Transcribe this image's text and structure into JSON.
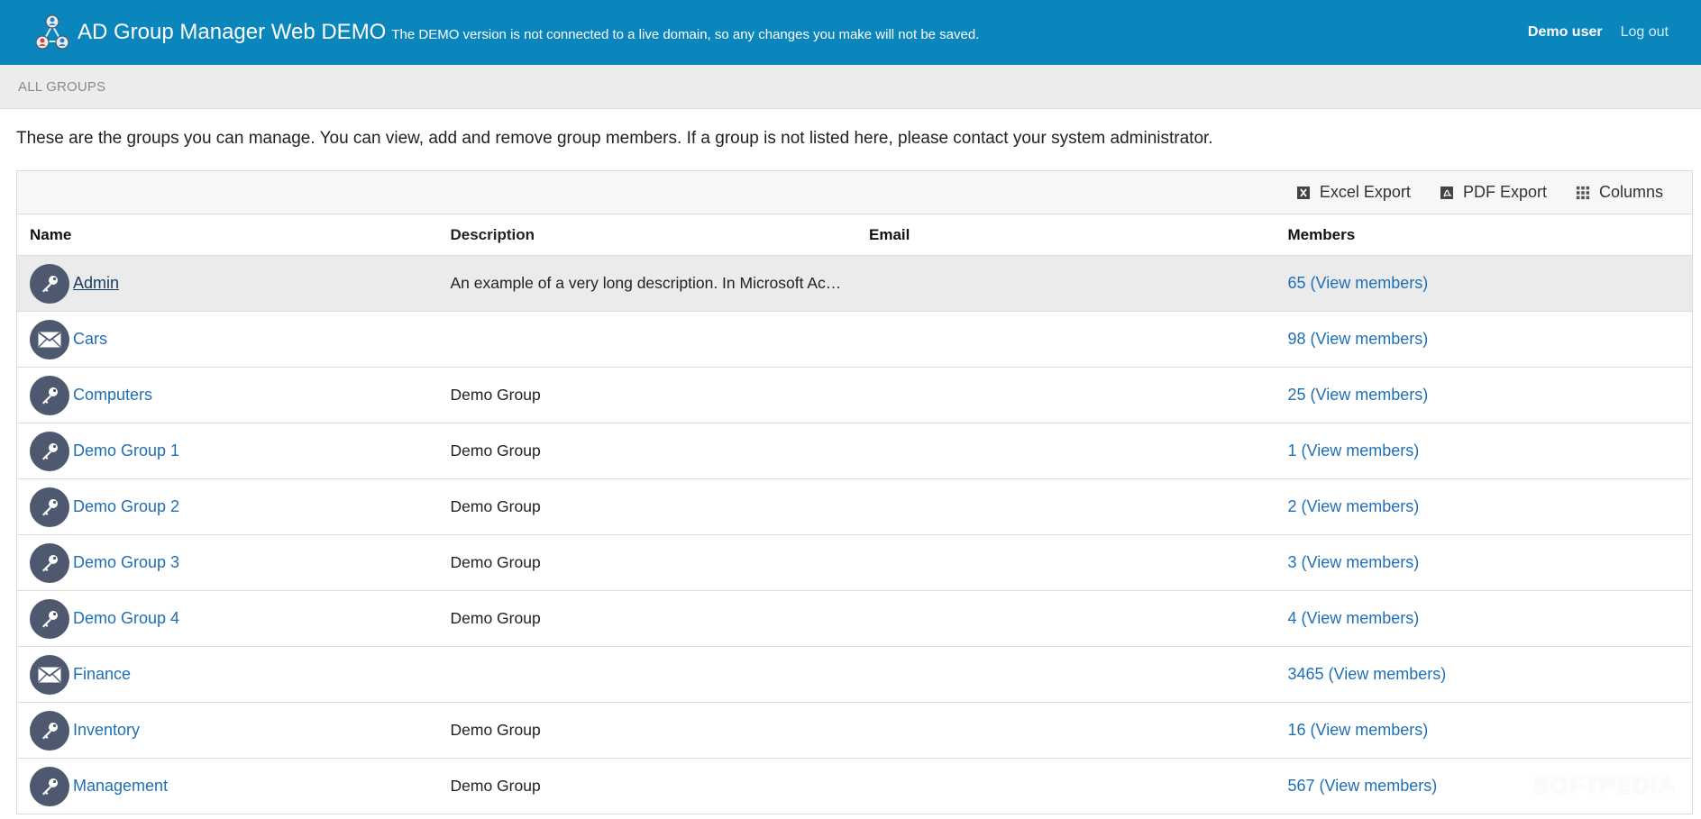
{
  "header": {
    "app_title": "AD Group Manager Web DEMO",
    "demo_note": "The DEMO version is not connected to a live domain, so any changes you make will not be saved.",
    "user_name": "Demo user",
    "logout_label": "Log out",
    "logo_icon": "group-network-logo-icon"
  },
  "breadcrumb": "ALL GROUPS",
  "intro": "These are the groups you can manage. You can view, add and remove group members. If a group is not listed here, please contact your system administrator.",
  "toolbar": {
    "excel_label": "Excel Export",
    "pdf_label": "PDF Export",
    "columns_label": "Columns"
  },
  "columns": {
    "name": "Name",
    "description": "Description",
    "email": "Email",
    "members": "Members"
  },
  "rows": [
    {
      "name": "Admin",
      "icon": "key",
      "description": "An example of a very long description. In Microsoft Ac…",
      "email": "",
      "members": "65 (View members)",
      "selected": true
    },
    {
      "name": "Cars",
      "icon": "mail",
      "description": "",
      "email": "",
      "members": "98 (View members)"
    },
    {
      "name": "Computers",
      "icon": "key",
      "description": "Demo Group",
      "email": "",
      "members": "25 (View members)"
    },
    {
      "name": "Demo Group 1",
      "icon": "key",
      "description": "Demo Group",
      "email": "",
      "members": "1 (View members)"
    },
    {
      "name": "Demo Group 2",
      "icon": "key",
      "description": "Demo Group",
      "email": "",
      "members": "2 (View members)"
    },
    {
      "name": "Demo Group 3",
      "icon": "key",
      "description": "Demo Group",
      "email": "",
      "members": "3 (View members)"
    },
    {
      "name": "Demo Group 4",
      "icon": "key",
      "description": "Demo Group",
      "email": "",
      "members": "4 (View members)"
    },
    {
      "name": "Finance",
      "icon": "mail",
      "description": "",
      "email": "",
      "members": "3465 (View members)"
    },
    {
      "name": "Inventory",
      "icon": "key",
      "description": "Demo Group",
      "email": "",
      "members": "16 (View members)"
    },
    {
      "name": "Management",
      "icon": "key",
      "description": "Demo Group",
      "email": "",
      "members": "567 (View members)"
    }
  ],
  "watermark": "SOFTPEDIA",
  "colors": {
    "header_bg": "#0a86bd",
    "link": "#1f6fb5",
    "icon_bg": "#4e5970"
  }
}
